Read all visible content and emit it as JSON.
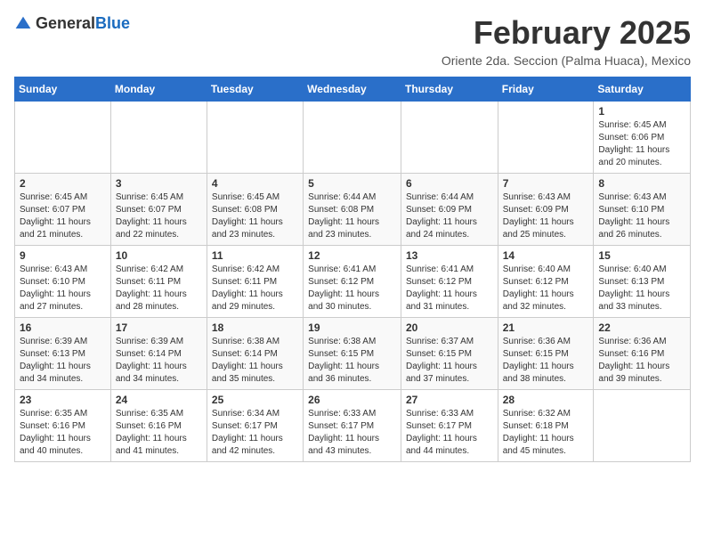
{
  "logo": {
    "general": "General",
    "blue": "Blue"
  },
  "title": "February 2025",
  "location": "Oriente 2da. Seccion (Palma Huaca), Mexico",
  "days_of_week": [
    "Sunday",
    "Monday",
    "Tuesday",
    "Wednesday",
    "Thursday",
    "Friday",
    "Saturday"
  ],
  "weeks": [
    [
      {
        "day": "",
        "details": ""
      },
      {
        "day": "",
        "details": ""
      },
      {
        "day": "",
        "details": ""
      },
      {
        "day": "",
        "details": ""
      },
      {
        "day": "",
        "details": ""
      },
      {
        "day": "",
        "details": ""
      },
      {
        "day": "1",
        "details": "Sunrise: 6:45 AM\nSunset: 6:06 PM\nDaylight: 11 hours\nand 20 minutes."
      }
    ],
    [
      {
        "day": "2",
        "details": "Sunrise: 6:45 AM\nSunset: 6:07 PM\nDaylight: 11 hours\nand 21 minutes."
      },
      {
        "day": "3",
        "details": "Sunrise: 6:45 AM\nSunset: 6:07 PM\nDaylight: 11 hours\nand 22 minutes."
      },
      {
        "day": "4",
        "details": "Sunrise: 6:45 AM\nSunset: 6:08 PM\nDaylight: 11 hours\nand 23 minutes."
      },
      {
        "day": "5",
        "details": "Sunrise: 6:44 AM\nSunset: 6:08 PM\nDaylight: 11 hours\nand 23 minutes."
      },
      {
        "day": "6",
        "details": "Sunrise: 6:44 AM\nSunset: 6:09 PM\nDaylight: 11 hours\nand 24 minutes."
      },
      {
        "day": "7",
        "details": "Sunrise: 6:43 AM\nSunset: 6:09 PM\nDaylight: 11 hours\nand 25 minutes."
      },
      {
        "day": "8",
        "details": "Sunrise: 6:43 AM\nSunset: 6:10 PM\nDaylight: 11 hours\nand 26 minutes."
      }
    ],
    [
      {
        "day": "9",
        "details": "Sunrise: 6:43 AM\nSunset: 6:10 PM\nDaylight: 11 hours\nand 27 minutes."
      },
      {
        "day": "10",
        "details": "Sunrise: 6:42 AM\nSunset: 6:11 PM\nDaylight: 11 hours\nand 28 minutes."
      },
      {
        "day": "11",
        "details": "Sunrise: 6:42 AM\nSunset: 6:11 PM\nDaylight: 11 hours\nand 29 minutes."
      },
      {
        "day": "12",
        "details": "Sunrise: 6:41 AM\nSunset: 6:12 PM\nDaylight: 11 hours\nand 30 minutes."
      },
      {
        "day": "13",
        "details": "Sunrise: 6:41 AM\nSunset: 6:12 PM\nDaylight: 11 hours\nand 31 minutes."
      },
      {
        "day": "14",
        "details": "Sunrise: 6:40 AM\nSunset: 6:12 PM\nDaylight: 11 hours\nand 32 minutes."
      },
      {
        "day": "15",
        "details": "Sunrise: 6:40 AM\nSunset: 6:13 PM\nDaylight: 11 hours\nand 33 minutes."
      }
    ],
    [
      {
        "day": "16",
        "details": "Sunrise: 6:39 AM\nSunset: 6:13 PM\nDaylight: 11 hours\nand 34 minutes."
      },
      {
        "day": "17",
        "details": "Sunrise: 6:39 AM\nSunset: 6:14 PM\nDaylight: 11 hours\nand 34 minutes."
      },
      {
        "day": "18",
        "details": "Sunrise: 6:38 AM\nSunset: 6:14 PM\nDaylight: 11 hours\nand 35 minutes."
      },
      {
        "day": "19",
        "details": "Sunrise: 6:38 AM\nSunset: 6:15 PM\nDaylight: 11 hours\nand 36 minutes."
      },
      {
        "day": "20",
        "details": "Sunrise: 6:37 AM\nSunset: 6:15 PM\nDaylight: 11 hours\nand 37 minutes."
      },
      {
        "day": "21",
        "details": "Sunrise: 6:36 AM\nSunset: 6:15 PM\nDaylight: 11 hours\nand 38 minutes."
      },
      {
        "day": "22",
        "details": "Sunrise: 6:36 AM\nSunset: 6:16 PM\nDaylight: 11 hours\nand 39 minutes."
      }
    ],
    [
      {
        "day": "23",
        "details": "Sunrise: 6:35 AM\nSunset: 6:16 PM\nDaylight: 11 hours\nand 40 minutes."
      },
      {
        "day": "24",
        "details": "Sunrise: 6:35 AM\nSunset: 6:16 PM\nDaylight: 11 hours\nand 41 minutes."
      },
      {
        "day": "25",
        "details": "Sunrise: 6:34 AM\nSunset: 6:17 PM\nDaylight: 11 hours\nand 42 minutes."
      },
      {
        "day": "26",
        "details": "Sunrise: 6:33 AM\nSunset: 6:17 PM\nDaylight: 11 hours\nand 43 minutes."
      },
      {
        "day": "27",
        "details": "Sunrise: 6:33 AM\nSunset: 6:17 PM\nDaylight: 11 hours\nand 44 minutes."
      },
      {
        "day": "28",
        "details": "Sunrise: 6:32 AM\nSunset: 6:18 PM\nDaylight: 11 hours\nand 45 minutes."
      },
      {
        "day": "",
        "details": ""
      }
    ]
  ]
}
